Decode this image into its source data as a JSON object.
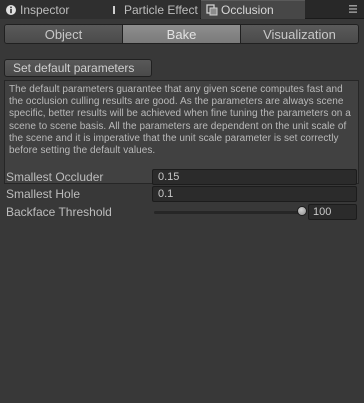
{
  "tabs": [
    {
      "label": "Inspector",
      "icon": "info-icon",
      "active": false
    },
    {
      "label": "Particle Effect",
      "icon": "particle-icon",
      "active": false
    },
    {
      "label": "Occlusion",
      "icon": "occlusion-icon",
      "active": true
    }
  ],
  "segmented": {
    "options": [
      "Object",
      "Bake",
      "Visualization"
    ],
    "selected": "Bake"
  },
  "set_default_button": "Set default parameters",
  "help_text": "The default parameters guarantee that any given scene computes fast and the occlusion culling results are good. As the parameters are always scene specific, better results will be achieved when fine tuning the parameters on a scene to scene basis. All the parameters are dependent on the unit scale of the scene and it is imperative that the unit scale parameter is set correctly before setting the default values.",
  "fields": {
    "smallest_occluder": {
      "label": "Smallest Occluder",
      "value": "0.15"
    },
    "smallest_hole": {
      "label": "Smallest Hole",
      "value": "0.1"
    },
    "backface_threshold": {
      "label": "Backface Threshold",
      "value": "100",
      "fraction": 1.0
    }
  },
  "colors": {
    "background": "#383838",
    "tabbar": "#282828",
    "selected_segment": "#8a8a8a"
  }
}
